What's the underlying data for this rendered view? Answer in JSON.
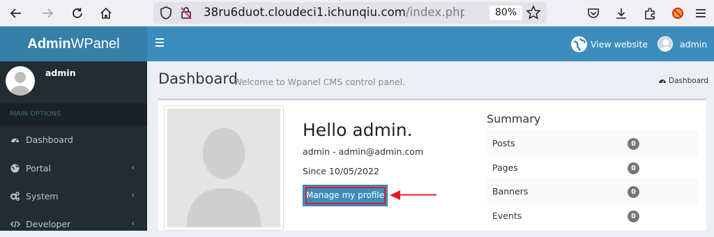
{
  "browser": {
    "url_host": "38ru6duot.cloudeci1.ichunqiu.com",
    "url_path": "/index.php/admin",
    "zoom": "80%"
  },
  "header": {
    "logo_bold": "Admin",
    "logo_rest": "WPanel",
    "view_website": "View website",
    "user": "admin"
  },
  "sidebar": {
    "user": "admin",
    "section": "MAIN OPTIONS",
    "items": [
      {
        "label": "Dashboard",
        "icon": "dashboard-icon"
      },
      {
        "label": "Portal",
        "icon": "globe-icon"
      },
      {
        "label": "System",
        "icon": "cogs-icon"
      },
      {
        "label": "Developer",
        "icon": "code-icon"
      }
    ],
    "chevron": "‹"
  },
  "content": {
    "title": "Dashboard",
    "subtitle": "Welcome to Wpanel CMS control panel.",
    "breadcrumb": "Dashboard"
  },
  "profile": {
    "greeting": "Hello admin.",
    "email_line": "admin - admin@admin.com",
    "since": "Since 10/05/2022",
    "button": "Manage my profile"
  },
  "summary": {
    "title": "Summary",
    "rows": [
      {
        "label": "Posts",
        "count": "0"
      },
      {
        "label": "Pages",
        "count": "0"
      },
      {
        "label": "Banners",
        "count": "0"
      },
      {
        "label": "Events",
        "count": "0"
      }
    ]
  },
  "colors": {
    "header_blue": "#3c8dbc",
    "logo_blue": "#367fa9",
    "sidebar_dark": "#222d32",
    "highlight_red": "#e01e26"
  }
}
